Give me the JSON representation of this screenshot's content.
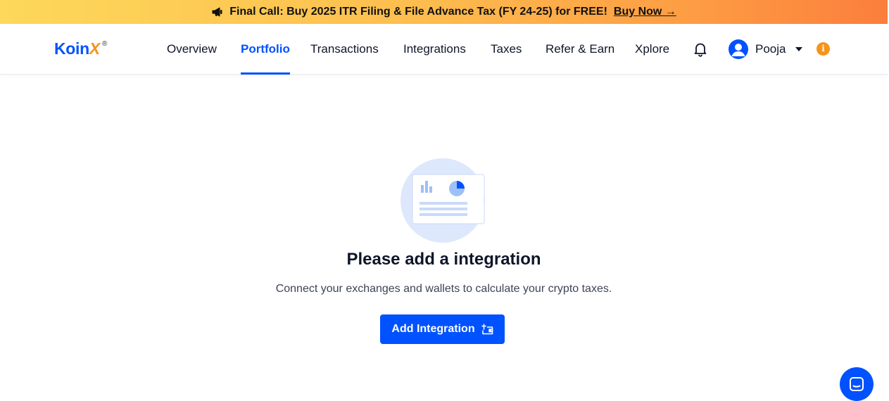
{
  "banner": {
    "text": "Final Call: Buy 2025 ITR Filing & File Advance Tax (FY 24-25) for FREE!",
    "link": "Buy Now →",
    "icon": "megaphone-icon"
  },
  "header": {
    "logo_main": "Koin",
    "logo_x": "X",
    "logo_reg": "®",
    "nav": [
      {
        "label": "Overview",
        "active": false
      },
      {
        "label": "Portfolio",
        "active": true
      },
      {
        "label": "Transactions",
        "active": false
      },
      {
        "label": "Integrations",
        "active": false
      },
      {
        "label": "Taxes",
        "active": false
      },
      {
        "label": "Refer & Earn",
        "active": false
      },
      {
        "label": "Xplore",
        "active": false
      }
    ],
    "user_name": "Pooja",
    "info_glyph": "i"
  },
  "empty_state": {
    "title": "Please add a integration",
    "description": "Connect your exchanges and wallets to calculate your crypto taxes.",
    "button_label": "Add Integration",
    "illustration": "report-chart-illustration"
  },
  "colors": {
    "accent": "#0052fe",
    "orange": "#f7931a",
    "illustration_bg": "#dde8fc"
  }
}
